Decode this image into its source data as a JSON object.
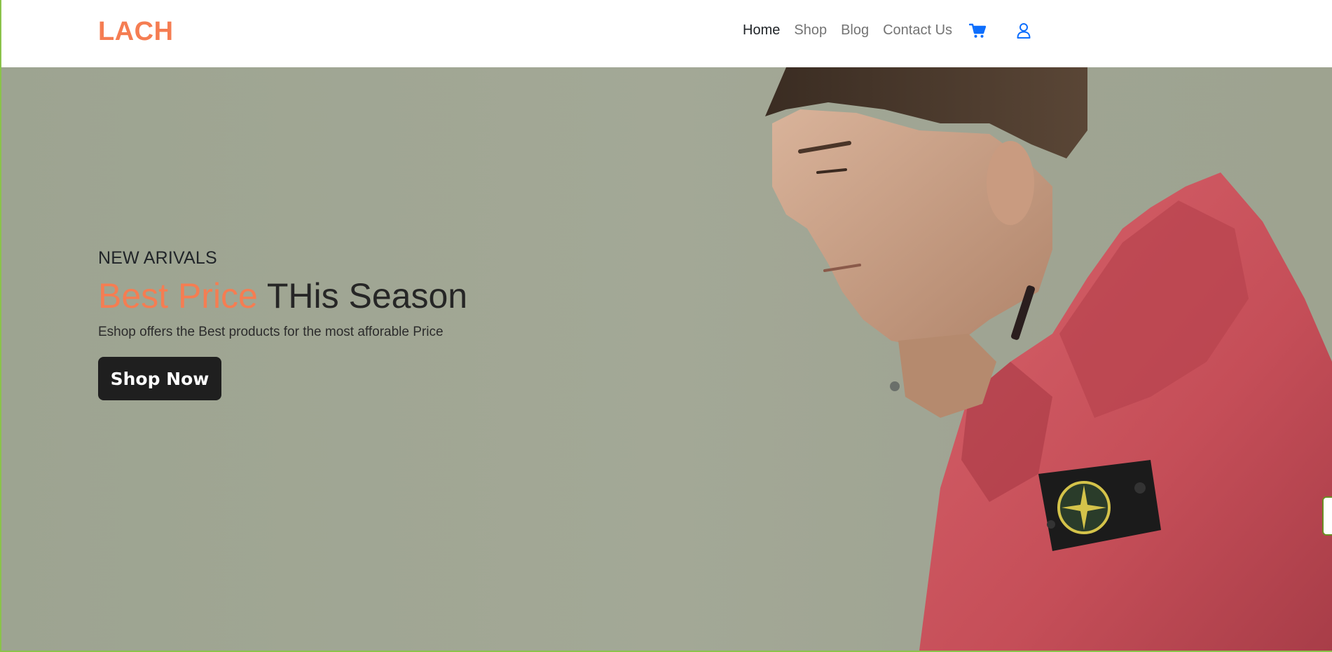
{
  "navbar": {
    "brand": "LACH",
    "links": [
      {
        "label": "Home",
        "active": true
      },
      {
        "label": "Shop",
        "active": false
      },
      {
        "label": "Blog",
        "active": false
      },
      {
        "label": "Contact Us",
        "active": false
      }
    ],
    "icons": {
      "cart": "cart-icon",
      "user": "user-icon"
    },
    "icon_color": "#0d6efd"
  },
  "hero": {
    "eyebrow": "NEW ARIVALS",
    "headline_accent": "Best Price",
    "headline_rest": "THis Season",
    "subtext": "Eshop offers the Best products for the most afforable Price",
    "cta_label": "Shop Now"
  },
  "colors": {
    "brand_accent": "#f57d52",
    "hero_background": "#a1a693",
    "button_dark": "#1f1f1f",
    "jacket_red": "#c8505a"
  }
}
